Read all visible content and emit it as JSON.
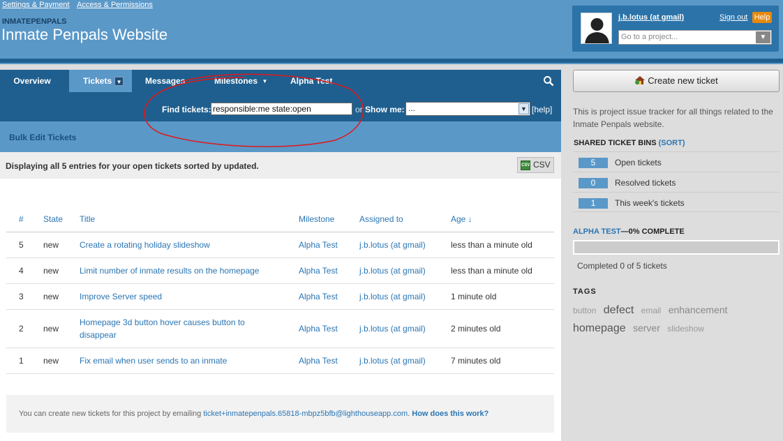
{
  "top_links": [
    "Settings & Payment",
    "Access & Permissions"
  ],
  "project": {
    "code": "INMATEPENPALS",
    "title": "Inmate Penpals Website"
  },
  "user": {
    "name": "j.b.lotus (at gmail)",
    "signout": "Sign out",
    "help": "Help",
    "goto_placeholder": "Go to a project..."
  },
  "tabs": [
    {
      "label": "Overview"
    },
    {
      "label": "Tickets"
    },
    {
      "label": "Messages"
    },
    {
      "label": "Milestones"
    },
    {
      "label": "Alpha Test"
    }
  ],
  "find": {
    "label": "Find tickets:",
    "value": "responsible:me state:open",
    "or": "or",
    "show_label": "Show me:",
    "show_value": "...",
    "help": "[help]"
  },
  "bulk_edit": "Bulk Edit Tickets",
  "info": {
    "text": "Displaying all 5 entries for your open tickets sorted by updated.",
    "csv": "CSV"
  },
  "columns": [
    "#",
    "State",
    "Title",
    "Milestone",
    "Assigned to",
    "Age ↓"
  ],
  "tickets": [
    {
      "num": "5",
      "state": "new",
      "title": "Create a rotating holiday slideshow",
      "milestone": "Alpha Test",
      "assigned": "j.b.lotus (at gmail)",
      "age": "less than a minute old"
    },
    {
      "num": "4",
      "state": "new",
      "title": "Limit number of inmate results on the homepage",
      "milestone": "Alpha Test",
      "assigned": "j.b.lotus (at gmail)",
      "age": "less than a minute old"
    },
    {
      "num": "3",
      "state": "new",
      "title": "Improve Server speed",
      "milestone": "Alpha Test",
      "assigned": "j.b.lotus (at gmail)",
      "age": "1 minute old"
    },
    {
      "num": "2",
      "state": "new",
      "title": "Homepage 3d button hover causes button to disappear",
      "milestone": "Alpha Test",
      "assigned": "j.b.lotus (at gmail)",
      "age": "2 minutes old"
    },
    {
      "num": "1",
      "state": "new",
      "title": "Fix email when user sends to an inmate",
      "milestone": "Alpha Test",
      "assigned": "j.b.lotus (at gmail)",
      "age": "7 minutes old"
    }
  ],
  "footer": {
    "text": "You can create new tickets for this project by emailing",
    "email": "ticket+inmatepenpals.65818-mbpz5bfb@lighthouseapp.com",
    "dot": ".",
    "how": "How does this work?"
  },
  "sidebar": {
    "create_button": "Create new ticket",
    "description": "This is project issue tracker for all things related to the Inmate Penpals website.",
    "bins_title": "SHARED TICKET BINS",
    "bins_sort": "(SORT)",
    "bins": [
      {
        "count": "5",
        "label": "Open tickets"
      },
      {
        "count": "0",
        "label": "Resolved tickets"
      },
      {
        "count": "1",
        "label": "This week's tickets"
      }
    ],
    "milestone_name": "ALPHA TEST",
    "milestone_status": "—0% COMPLETE",
    "milestone_progress": 0,
    "completed": "Completed 0 of 5 tickets",
    "tags_title": "TAGS",
    "tags": [
      {
        "name": "button",
        "size": "small"
      },
      {
        "name": "defect",
        "size": "large"
      },
      {
        "name": "email",
        "size": "small"
      },
      {
        "name": "enhancement",
        "size": "medium"
      },
      {
        "name": "homepage",
        "size": "large"
      },
      {
        "name": "server",
        "size": "medium"
      },
      {
        "name": "slideshow",
        "size": "small"
      }
    ]
  },
  "colors": {
    "header_blue": "#5a98c8",
    "nav_dark": "#1f5f8f",
    "link": "#2a75b3",
    "state_new": "#e0106e",
    "help_orange": "#e8880c"
  },
  "annotation": {
    "type": "red hand-drawn ellipse around find tickets field"
  }
}
